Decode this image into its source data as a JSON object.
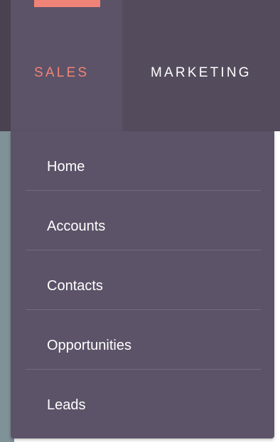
{
  "nav": {
    "tabs": [
      {
        "label": "SALES",
        "active": true
      },
      {
        "label": "MARKETING",
        "active": false
      }
    ],
    "active_color": "#f08377",
    "bar_color": "#544c5d"
  },
  "dropdown": {
    "items": [
      {
        "label": "Home"
      },
      {
        "label": "Accounts"
      },
      {
        "label": "Contacts"
      },
      {
        "label": "Opportunities"
      },
      {
        "label": "Leads"
      }
    ],
    "background": "#5c5368"
  }
}
